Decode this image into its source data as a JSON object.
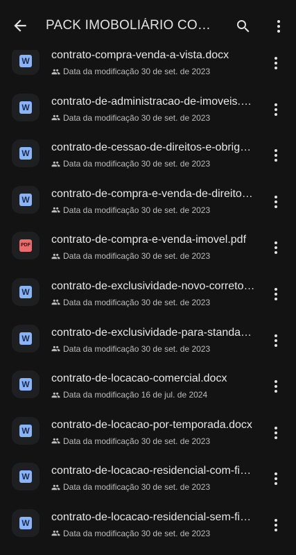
{
  "header": {
    "title": "PACK IMOBOLIÁRIO CONTRATOS",
    "back_icon": "arrow-left-icon",
    "search_icon": "search-icon",
    "more_icon": "more-vert-icon"
  },
  "colors": {
    "background": "#131314",
    "word_icon": "#8ab4f8",
    "pdf_icon": "#ec6b6b",
    "text_primary": "#e8e8e8",
    "text_secondary": "#bdbdbd"
  },
  "files": [
    {
      "name": "contrato-compra-venda-a-vista.docx",
      "type": "word",
      "type_label": "W",
      "meta": "Data da modificação 30 de set. de 2023"
    },
    {
      "name": "contrato-de-administracao-de-imoveis.docx",
      "type": "word",
      "type_label": "W",
      "meta": "Data da modificação 30 de set. de 2023"
    },
    {
      "name": "contrato-de-cessao-de-direitos-e-obrigacoes.docx",
      "type": "word",
      "type_label": "W",
      "meta": "Data da modificação 30 de set. de 2023"
    },
    {
      "name": "contrato-de-compra-e-venda-de-direitos.docx",
      "type": "word",
      "type_label": "W",
      "meta": "Data da modificação 30 de set. de 2023"
    },
    {
      "name": "contrato-de-compra-e-venda-imovel.pdf",
      "type": "pdf",
      "type_label": "PDF",
      "meta": "Data da modificação 30 de set. de 2023"
    },
    {
      "name": "contrato-de-exclusividade-novo-corretor.docx",
      "type": "word",
      "type_label": "W",
      "meta": "Data da modificação 30 de set. de 2023"
    },
    {
      "name": "contrato-de-exclusividade-para-standard.docx",
      "type": "word",
      "type_label": "W",
      "meta": "Data da modificação 30 de set. de 2023"
    },
    {
      "name": "contrato-de-locacao-comercial.docx",
      "type": "word",
      "type_label": "W",
      "meta": "Data da modificação 16 de jul. de 2024"
    },
    {
      "name": "contrato-de-locacao-por-temporada.docx",
      "type": "word",
      "type_label": "W",
      "meta": "Data da modificação 30 de set. de 2023"
    },
    {
      "name": "contrato-de-locacao-residencial-com-fiador.docx",
      "type": "word",
      "type_label": "W",
      "meta": "Data da modificação 30 de set. de 2023"
    },
    {
      "name": "contrato-de-locacao-residencial-sem-fiador.docx",
      "type": "word",
      "type_label": "W",
      "meta": "Data da modificação 30 de set. de 2023"
    }
  ]
}
